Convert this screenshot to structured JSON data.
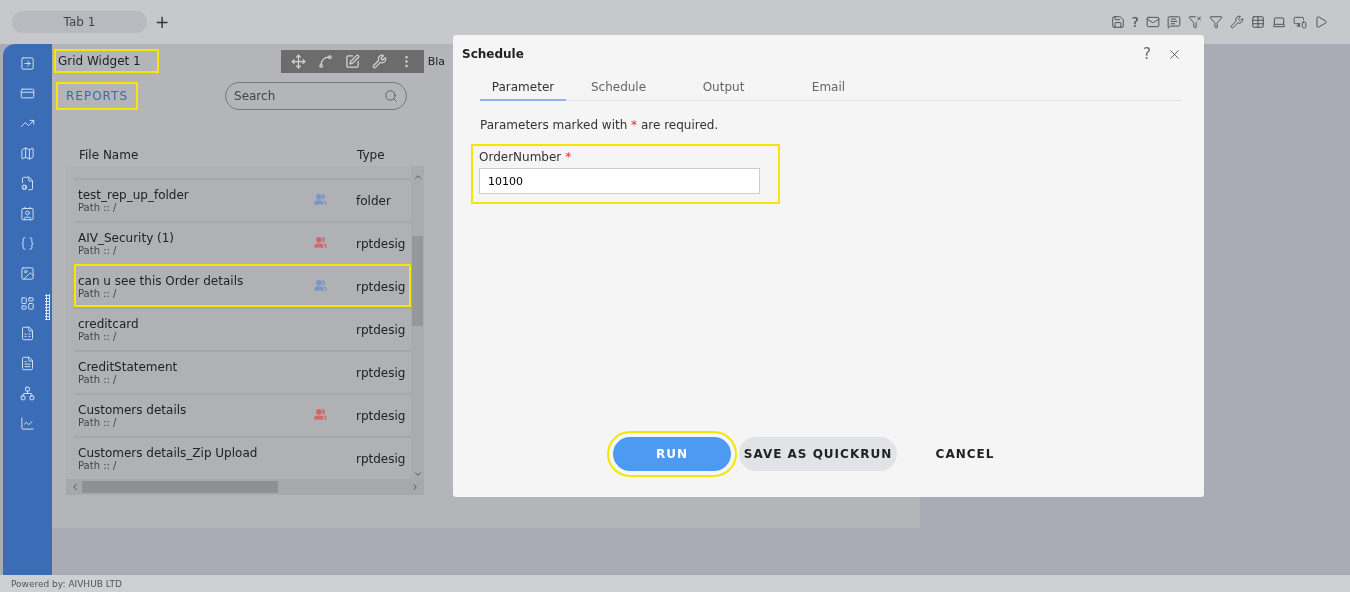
{
  "tabs": [
    {
      "label": "Tab 1",
      "selected": true
    }
  ],
  "new_tab": "+",
  "toolbar_help": "?",
  "widget": {
    "title": "Grid Widget 1",
    "title_highlighted": true,
    "cut_text": "Bla",
    "section": "REPORTS",
    "section_highlighted": true,
    "search": {
      "placeholder": "Search"
    },
    "columns": [
      "File Name",
      "Type"
    ],
    "rows": [
      {
        "name": "test_rep_up_folder",
        "path": "Path :: /",
        "type": "folder",
        "color": "#7b93c9",
        "highlighted": false
      },
      {
        "name": "AIV_Security (1)",
        "path": "Path :: /",
        "type": "rptdesig",
        "color": "#d2676a",
        "highlighted": false
      },
      {
        "name": "can u see this Order details",
        "path": "Path :: /",
        "type": "rptdesig",
        "color": "#7b93c9",
        "highlighted": true
      },
      {
        "name": "creditcard",
        "path": "Path :: /",
        "type": "rptdesig",
        "highlighted": false
      },
      {
        "name": "CreditStatement",
        "path": "Path :: /",
        "type": "rptdesig",
        "highlighted": false
      },
      {
        "name": "Customers details",
        "path": "Path :: /",
        "type": "rptdesig",
        "color": "#d2676a",
        "highlighted": false
      },
      {
        "name": "Customers details_Zip Upload",
        "path": "Path :: /",
        "type": "rptdesig",
        "highlighted": false
      }
    ]
  },
  "dialog": {
    "title": "Schedule",
    "help": "?",
    "tabs": [
      {
        "label": "Parameter",
        "selected": true
      },
      {
        "label": "Schedule",
        "selected": false
      },
      {
        "label": "Output",
        "selected": false
      },
      {
        "label": "Email",
        "selected": false
      }
    ],
    "note": {
      "before": "Parameters marked with",
      "mark": "*",
      "after": "are required."
    },
    "parameter": {
      "label": "OrderNumber",
      "required_mark": "*",
      "value": "10100",
      "highlighted": true
    },
    "buttons": [
      {
        "label": "RUN",
        "kind": "primary",
        "highlighted": true
      },
      {
        "label": "SAVE AS QUICKRUN",
        "kind": "secondary",
        "highlighted": false
      },
      {
        "label": "CANCEL",
        "kind": "text",
        "highlighted": false
      }
    ]
  },
  "footer": "Powered by: AIVHUB LTD"
}
